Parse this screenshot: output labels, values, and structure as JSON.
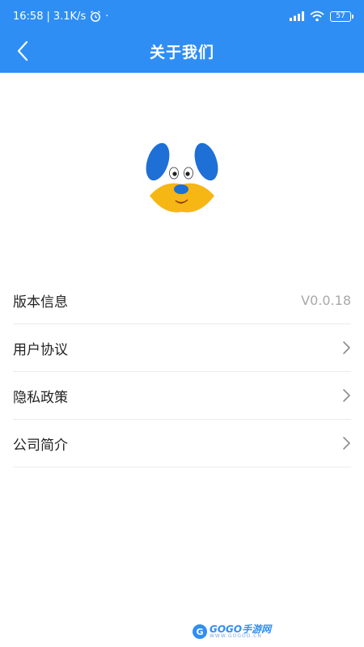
{
  "status_bar": {
    "time": "16:58",
    "speed": "3.1K/s",
    "battery": "57"
  },
  "nav": {
    "title": "关于我们"
  },
  "about": {
    "version_label": "版本信息",
    "version_value": "V0.0.18",
    "user_agreement": "用户协议",
    "privacy_policy": "隐私政策",
    "company_intro": "公司简介"
  },
  "watermark": {
    "badge": "G",
    "brand": "GOGO手游网",
    "url": "WWW.GOGOD.CN"
  },
  "colors": {
    "primary": "#2f8ef4",
    "logo_blue": "#1e6fd6",
    "logo_yellow": "#f6b614"
  }
}
